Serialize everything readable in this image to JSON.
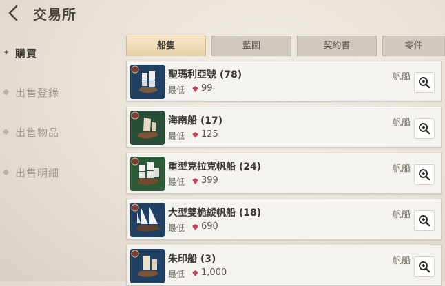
{
  "header": {
    "title": "交易所"
  },
  "sidebar": {
    "items": [
      {
        "label": "購買",
        "active": true
      },
      {
        "label": "出售登錄",
        "active": false
      },
      {
        "label": "出售物品",
        "active": false
      },
      {
        "label": "出售明細",
        "active": false
      }
    ]
  },
  "tabs": [
    {
      "label": "船隻",
      "active": true
    },
    {
      "label": "藍圖",
      "active": false
    },
    {
      "label": "契約書",
      "active": false
    },
    {
      "label": "零件",
      "active": false
    }
  ],
  "listings": [
    {
      "name": "聖瑪利亞號 (78)",
      "min_label": "最低",
      "price": "99",
      "type": "帆船",
      "thumb_bg": "#1f3f63"
    },
    {
      "name": "海南船 (17)",
      "min_label": "最低",
      "price": "125",
      "type": "帆船",
      "thumb_bg": "#2a4d3a"
    },
    {
      "name": "重型克拉克帆船 (24)",
      "min_label": "最低",
      "price": "399",
      "type": "帆船",
      "thumb_bg": "#2a5a38"
    },
    {
      "name": "大型雙桅縱帆船 (18)",
      "min_label": "最低",
      "price": "690",
      "type": "帆船",
      "thumb_bg": "#1f3f63"
    },
    {
      "name": "朱印船 (3)",
      "min_label": "最低",
      "price": "1,000",
      "type": "帆船",
      "thumb_bg": "#1f3f63"
    }
  ],
  "colors": {
    "gem": "#c7435a",
    "active_tab": "#efd9b4"
  },
  "icons": {
    "back": "chevron-left-icon",
    "zoom": "magnifier-plus-icon",
    "currency": "gem-icon",
    "bullet": "diamond-bullet-icon"
  }
}
